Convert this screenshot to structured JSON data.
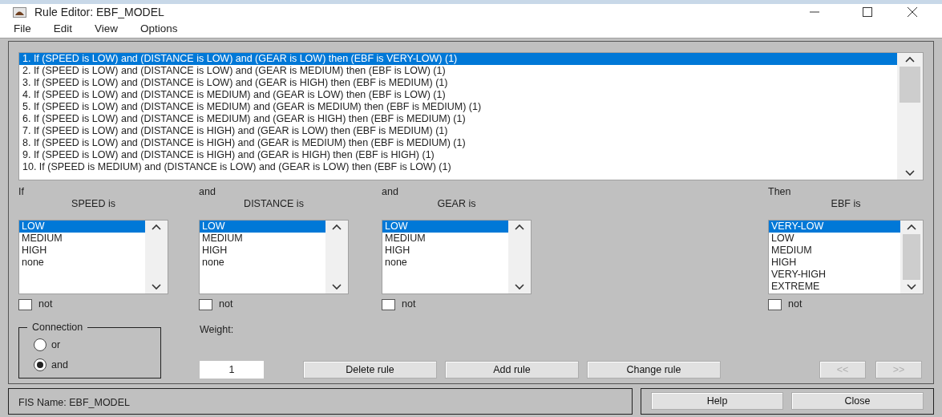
{
  "window": {
    "title": "Rule Editor: EBF_MODEL"
  },
  "menu": [
    "File",
    "Edit",
    "View",
    "Options"
  ],
  "rules": [
    {
      "text": "1. If (SPEED is LOW) and (DISTANCE is LOW) and (GEAR is LOW) then (EBF is VERY-LOW) (1)",
      "selected": true
    },
    {
      "text": "2. If (SPEED is LOW) and (DISTANCE is LOW) and (GEAR is MEDIUM) then (EBF is LOW) (1)",
      "selected": false
    },
    {
      "text": "3. If (SPEED is LOW) and (DISTANCE is LOW) and (GEAR is HIGH) then (EBF is MEDIUM) (1)",
      "selected": false
    },
    {
      "text": "4. If (SPEED is LOW) and (DISTANCE is MEDIUM) and (GEAR is LOW) then (EBF is LOW) (1)",
      "selected": false
    },
    {
      "text": "5. If (SPEED is LOW) and (DISTANCE is MEDIUM) and (GEAR is MEDIUM) then (EBF is MEDIUM) (1)",
      "selected": false
    },
    {
      "text": "6. If (SPEED is LOW) and (DISTANCE is MEDIUM) and (GEAR is HIGH) then (EBF is MEDIUM) (1)",
      "selected": false
    },
    {
      "text": "7. If (SPEED is LOW) and (DISTANCE is HIGH) and (GEAR is LOW) then (EBF is MEDIUM) (1)",
      "selected": false
    },
    {
      "text": "8. If (SPEED is LOW) and (DISTANCE is HIGH) and (GEAR is MEDIUM) then (EBF is MEDIUM) (1)",
      "selected": false
    },
    {
      "text": "9. If (SPEED is LOW) and (DISTANCE is HIGH) and (GEAR is HIGH) then (EBF is HIGH) (1)",
      "selected": false
    },
    {
      "text": "10. If (SPEED is MEDIUM) and (DISTANCE is LOW) and (GEAR is LOW) then (EBF is LOW) (1)",
      "selected": false
    }
  ],
  "antecedents": [
    {
      "connector": "If",
      "label": "SPEED is",
      "options": [
        {
          "label": "LOW",
          "selected": true
        },
        {
          "label": "MEDIUM",
          "selected": false
        },
        {
          "label": "HIGH",
          "selected": false
        },
        {
          "label": "none",
          "selected": false
        }
      ],
      "not": {
        "label": "not",
        "checked": false
      }
    },
    {
      "connector": "and",
      "label": "DISTANCE is",
      "options": [
        {
          "label": "LOW",
          "selected": true
        },
        {
          "label": "MEDIUM",
          "selected": false
        },
        {
          "label": "HIGH",
          "selected": false
        },
        {
          "label": "none",
          "selected": false
        }
      ],
      "not": {
        "label": "not",
        "checked": false
      }
    },
    {
      "connector": "and",
      "label": "GEAR is",
      "options": [
        {
          "label": "LOW",
          "selected": true
        },
        {
          "label": "MEDIUM",
          "selected": false
        },
        {
          "label": "HIGH",
          "selected": false
        },
        {
          "label": "none",
          "selected": false
        }
      ],
      "not": {
        "label": "not",
        "checked": false
      }
    }
  ],
  "consequent": {
    "connector": "Then",
    "label": "EBF is",
    "options": [
      {
        "label": "VERY-LOW",
        "selected": true
      },
      {
        "label": "LOW",
        "selected": false
      },
      {
        "label": "MEDIUM",
        "selected": false
      },
      {
        "label": "HIGH",
        "selected": false
      },
      {
        "label": "VERY-HIGH",
        "selected": false
      },
      {
        "label": "EXTREME",
        "selected": false
      }
    ],
    "not": {
      "label": "not",
      "checked": false
    }
  },
  "connection": {
    "title": "Connection",
    "options": [
      {
        "label": "or",
        "selected": false
      },
      {
        "label": "and",
        "selected": true
      }
    ]
  },
  "weight": {
    "label": "Weight:",
    "value": "1"
  },
  "rule_buttons": [
    {
      "label": "Delete rule",
      "disabled": false
    },
    {
      "label": "Add rule",
      "disabled": false
    },
    {
      "label": "Change rule",
      "disabled": false
    }
  ],
  "nav_buttons": [
    {
      "label": "<<",
      "disabled": true
    },
    {
      "label": ">>",
      "disabled": true
    }
  ],
  "status": {
    "text": "FIS Name: EBF_MODEL"
  },
  "footer_buttons": [
    {
      "label": "Help",
      "disabled": false
    },
    {
      "label": "Close",
      "disabled": false
    }
  ]
}
